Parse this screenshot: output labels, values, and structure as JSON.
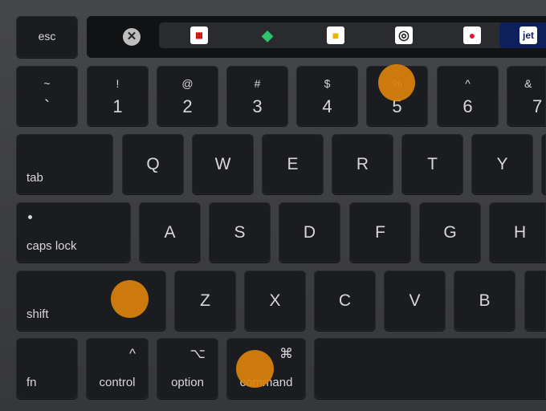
{
  "accent_color": "#db820c",
  "highlighted_keys": [
    "5",
    "shift",
    "command"
  ],
  "touch_bar": {
    "esc": "esc",
    "close_icon": "close-icon",
    "apps": [
      {
        "icon": "newspaper-app-icon",
        "text": ""
      },
      {
        "icon": "green-leaf-app-icon",
        "text": ""
      },
      {
        "icon": "yellow-mug-app-icon",
        "text": ""
      },
      {
        "icon": "circle-logo-app-icon",
        "text": ""
      },
      {
        "icon": "red-dot-app-icon",
        "text": ""
      },
      {
        "icon": "jet-app-icon",
        "text": "jet"
      }
    ]
  },
  "rows": {
    "number": [
      {
        "top": "~",
        "main": "`"
      },
      {
        "top": "!",
        "main": "1"
      },
      {
        "top": "@",
        "main": "2"
      },
      {
        "top": "#",
        "main": "3"
      },
      {
        "top": "$",
        "main": "4"
      },
      {
        "top": "%",
        "main": "5"
      },
      {
        "top": "^",
        "main": "6"
      },
      {
        "top": "&",
        "main": "7"
      }
    ],
    "qwerty": [
      "tab",
      "Q",
      "W",
      "E",
      "R",
      "T",
      "Y"
    ],
    "home": [
      "caps lock",
      "A",
      "S",
      "D",
      "F",
      "G",
      "H"
    ],
    "bottom": [
      "shift",
      "Z",
      "X",
      "C",
      "V",
      "B"
    ],
    "modifiers": [
      {
        "label": "fn",
        "symbol": ""
      },
      {
        "label": "control",
        "symbol": "^"
      },
      {
        "label": "option",
        "symbol": "⌥"
      },
      {
        "label": "command",
        "symbol": "⌘"
      }
    ]
  }
}
